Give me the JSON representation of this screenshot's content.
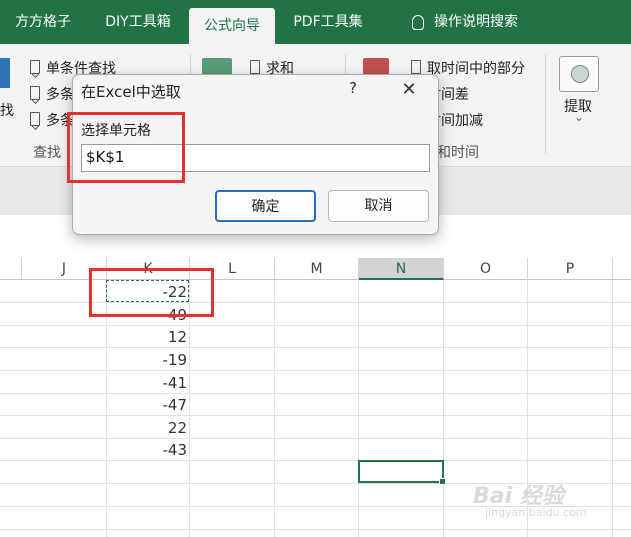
{
  "tabs": [
    {
      "label": "方方格子",
      "active": false
    },
    {
      "label": "DIY工具箱",
      "active": false
    },
    {
      "label": "公式向导",
      "active": true
    },
    {
      "label": "PDF工具集",
      "active": false
    },
    {
      "label": "操作说明搜索",
      "active": false
    }
  ],
  "ribbon": {
    "items_left": [
      "单条件查找",
      "多条",
      "多条"
    ],
    "left_group_fragment": "找",
    "group_label_left": "查找",
    "sum_label": "求和",
    "right_items": [
      "取时间中的部分",
      "时间差",
      "时间加减"
    ],
    "group_label_right": "和时间",
    "extract_label": "提取",
    "extract_chevron": "⌄"
  },
  "dialog": {
    "title": "在Excel中选取",
    "help": "?",
    "close": "✕",
    "field_label": "选择单元格",
    "field_value": "$K$1",
    "ok_label": "确定",
    "cancel_label": "取消"
  },
  "grid": {
    "columns": [
      "J",
      "K",
      "L",
      "M",
      "N",
      "O",
      "P"
    ],
    "selected_column": "N",
    "k_values": [
      "-22",
      "-49",
      "12",
      "-19",
      "-41",
      "-47",
      "22",
      "-43"
    ]
  },
  "watermark": {
    "line1": "Bai 经验",
    "line2": "jingyan.baidu.com"
  },
  "colors": {
    "excel_green": "#217346",
    "highlight_red": "#e0322f",
    "ok_button_border": "#2b6cc4"
  }
}
